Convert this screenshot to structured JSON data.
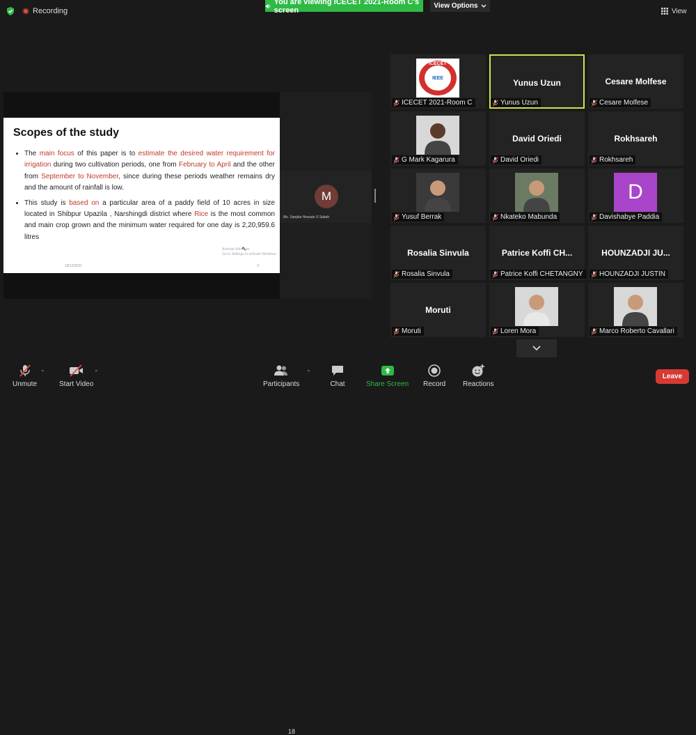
{
  "header": {
    "recording_label": "Recording",
    "share_banner": "You are viewing ICECET 2021-Room C's screen",
    "view_options": "View Options",
    "view_label": "View"
  },
  "slide": {
    "title": "Scopes of the study",
    "b1": {
      "t1": "The ",
      "h1": "main focus",
      "t2": " of this paper is to ",
      "h2": "estimate the desired water requirement for irrigation",
      "t3": " during two cultivation periods, one from ",
      "h3": "February to April",
      "t4": " and the other from ",
      "h4": "September to November",
      "t5": ", since during these periods weather remains dry and the amount of rainfall is low."
    },
    "b2": {
      "t1": "This study is ",
      "h1": "based on",
      "t2": " a particular area of a paddy field of 10 acres in size located in Shibpur Upazila , Narshingdi district where ",
      "h2": "Rice",
      "t3": " is the most common and main crop grown and the minimum water required for one day is 2,20,959.6 litres"
    },
    "date": "18/12/2021",
    "page": "3",
    "watermark_line1": "Activate Windows",
    "watermark_line2": "Go to Settings to activate Windows."
  },
  "presenter": {
    "initial": "M",
    "name": "Ms. Sanjida Hossain S Sabah"
  },
  "participants": [
    {
      "big": "",
      "label": "ICECET 2021-Room C",
      "logo_text": "ICECET",
      "logo_inner": "IEEE"
    },
    {
      "big": "Yunus Uzun",
      "label": "Yunus Uzun"
    },
    {
      "big": "Cesare Molfese",
      "label": "Cesare Molfese"
    },
    {
      "big": "",
      "label": "G Mark Kagarura"
    },
    {
      "big": "David Oriedi",
      "label": "David Oriedi"
    },
    {
      "big": "Rokhsareh",
      "label": "Rokhsareh"
    },
    {
      "big": "",
      "label": "Yusuf Berrak"
    },
    {
      "big": "",
      "label": "Nkateko Mabunda"
    },
    {
      "big": "",
      "label": "Davishabye Paddia",
      "initial": "D"
    },
    {
      "big": "Rosalia Sinvula",
      "label": "Rosalia Sinvula"
    },
    {
      "big": "Patrice Koffi CH...",
      "label": "Patrice Koffi CHETANGNY"
    },
    {
      "big": "HOUNZADJI  JU...",
      "label": "HOUNZADJI  JUSTIN"
    },
    {
      "big": "Moruti",
      "label": "Moruti"
    },
    {
      "big": "",
      "label": "Loren Mora"
    },
    {
      "big": "",
      "label": "Marco Roberto Cavallari"
    }
  ],
  "toolbar": {
    "unmute": "Unmute",
    "start_video": "Start Video",
    "participants": "Participants",
    "participants_count": "18",
    "chat": "Chat",
    "share_screen": "Share Screen",
    "record": "Record",
    "reactions": "Reactions",
    "leave": "Leave"
  },
  "colors": {
    "share_green": "#2fb945",
    "leave_red": "#d63a33",
    "active_speaker": "#cfe24d",
    "highlight_text": "#c0392b"
  },
  "icons": [
    "shield-check-icon",
    "record-dot-icon",
    "speaker-icon",
    "chevron-down-icon",
    "grid-icon",
    "mic-off-icon",
    "video-off-icon",
    "participants-icon",
    "chat-icon",
    "share-screen-icon",
    "record-icon",
    "reactions-icon"
  ]
}
